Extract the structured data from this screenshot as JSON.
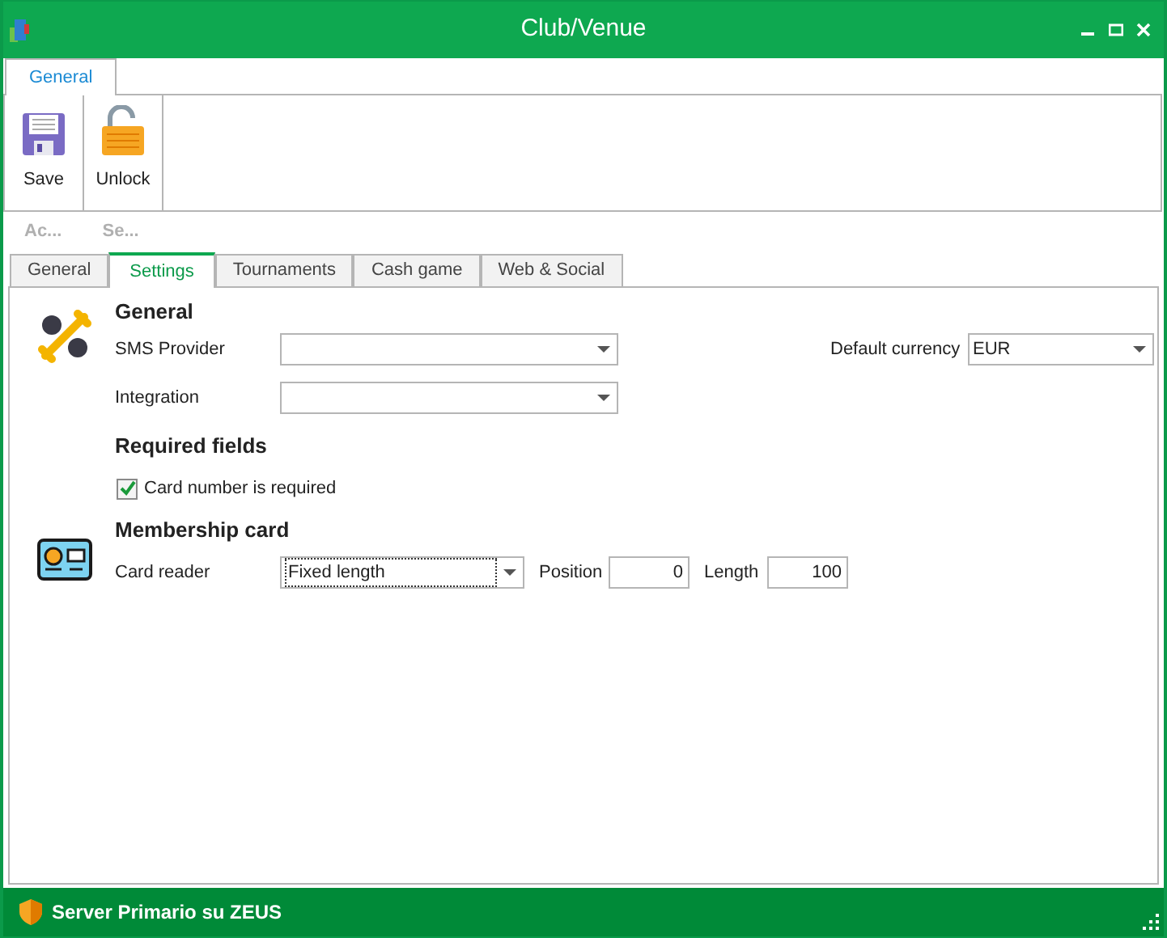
{
  "window": {
    "title": "Club/Venue"
  },
  "ribbon": {
    "tabs": [
      {
        "label": "General",
        "selected": true
      }
    ],
    "buttons": [
      {
        "label": "Save",
        "kind": "save"
      },
      {
        "label": "Unlock",
        "kind": "unlock"
      }
    ],
    "groups": [
      "Ac...",
      "Se..."
    ]
  },
  "tabs": [
    {
      "label": "General",
      "selected": false
    },
    {
      "label": "Settings",
      "selected": true
    },
    {
      "label": "Tournaments",
      "selected": false
    },
    {
      "label": "Cash game",
      "selected": false
    },
    {
      "label": "Web & Social",
      "selected": false
    }
  ],
  "general": {
    "heading": "General",
    "sms_provider": {
      "label": "SMS Provider"
    },
    "integration": {
      "label": "Integration"
    },
    "default_currency": {
      "label": "Default currency",
      "value": "EUR"
    }
  },
  "required_fields": {
    "heading": "Required fields",
    "checkbox": {
      "label": "Card number is required",
      "checked": true
    }
  },
  "membership_card": {
    "heading": "Membership card",
    "card_reader": {
      "label": "Card reader",
      "value": "Fixed length"
    },
    "position": {
      "label": "Position",
      "value": "0"
    },
    "length": {
      "label": "Length",
      "value": "100"
    }
  },
  "status_bar": {
    "text": "Server Primario su ZEUS"
  }
}
